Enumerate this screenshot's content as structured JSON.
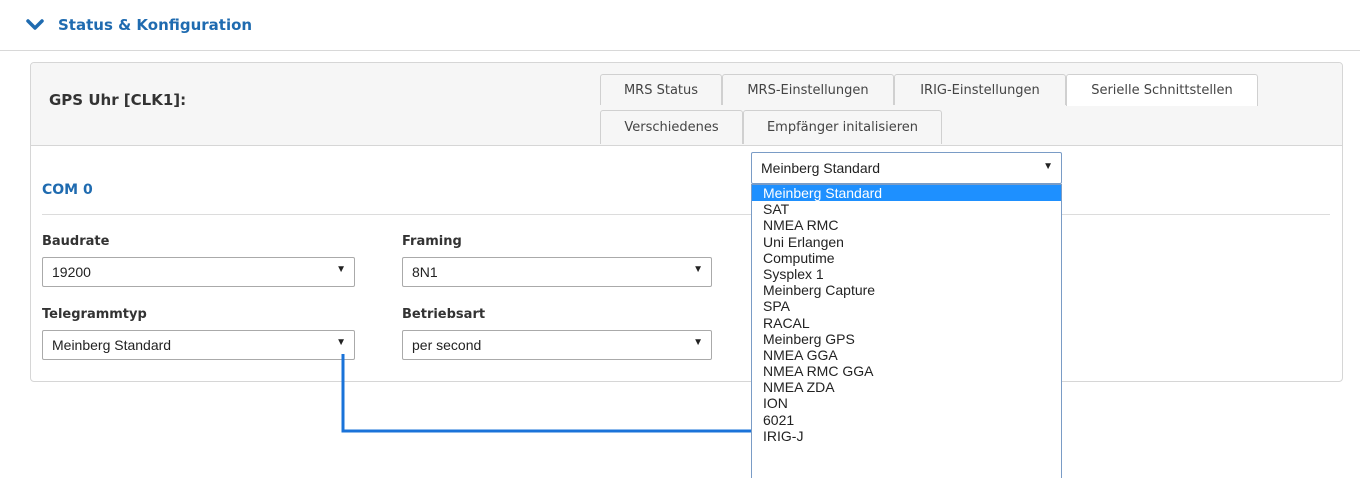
{
  "header": {
    "title": "Status & Konfiguration",
    "chevron_icon": "chevron-down-icon",
    "color": "#1f6bb0"
  },
  "panel": {
    "title": "GPS Uhr [CLK1]:",
    "tabs": [
      {
        "label": "MRS Status",
        "active": false
      },
      {
        "label": "MRS-Einstellungen",
        "active": false
      },
      {
        "label": "IRIG-Einstellungen",
        "active": false
      },
      {
        "label": "Serielle Schnittstellen",
        "active": true
      },
      {
        "label": "Verschiedenes",
        "active": false
      },
      {
        "label": "Empfänger initalisieren",
        "active": false
      }
    ]
  },
  "com": {
    "title": "COM 0",
    "baudrate_label": "Baudrate",
    "baudrate_value": "19200",
    "framing_label": "Framing",
    "framing_value": "8N1",
    "telegram_label": "Telegrammtyp",
    "telegram_value": "Meinberg Standard",
    "mode_label": "Betriebsart",
    "mode_value": "per second"
  },
  "dropdown": {
    "value": "Meinberg Standard",
    "options": [
      "Meinberg Standard",
      "SAT",
      "NMEA RMC",
      "Uni Erlangen",
      "Computime",
      "Sysplex 1",
      "Meinberg Capture",
      "SPA",
      "RACAL",
      "Meinberg GPS",
      "NMEA GGA",
      "NMEA RMC GGA",
      "NMEA ZDA",
      "ION",
      "6021",
      "IRIG-J"
    ],
    "highlighted": "Meinberg Standard",
    "highlight_color": "#1e90ff",
    "connector_color": "#1a73d9"
  }
}
